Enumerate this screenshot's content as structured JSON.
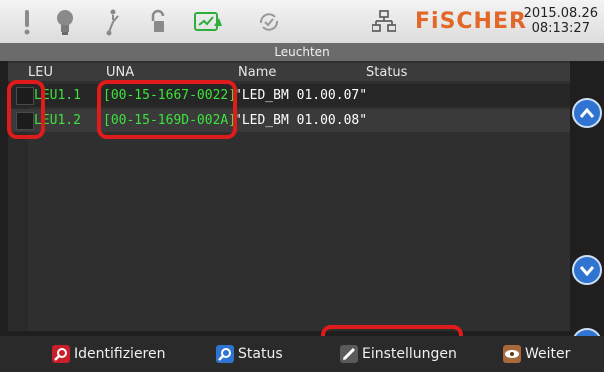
{
  "header": {
    "brand": "FiSCHER",
    "date": "2015.08.26",
    "time": "08:13:27",
    "icons": [
      "alert-icon",
      "bulb-icon",
      "switch-icon",
      "unlock-icon",
      "screen-chart-icon",
      "sync-icon",
      "network-icon"
    ]
  },
  "window_title": "Leuchten",
  "table": {
    "columns": [
      "LEU",
      "UNA",
      "Name",
      "Status"
    ],
    "rows": [
      {
        "leu": "LEU1.1",
        "una": "[00-15-1667-0022]",
        "name": "\"LED_BM 01.00.07\"",
        "status": ""
      },
      {
        "leu": "LEU1.2",
        "una": "[00-15-169D-002A]",
        "name": "\"LED_BM 01.00.08\"",
        "status": ""
      }
    ]
  },
  "footer": {
    "identify": "Identifizieren",
    "status": "Status",
    "settings": "Einstellungen",
    "more": "Weiter"
  },
  "colors": {
    "accent": "#2f74d0",
    "brand": "#e4672a",
    "highlight": "#e01b1b",
    "text_green": "#3de33d"
  }
}
